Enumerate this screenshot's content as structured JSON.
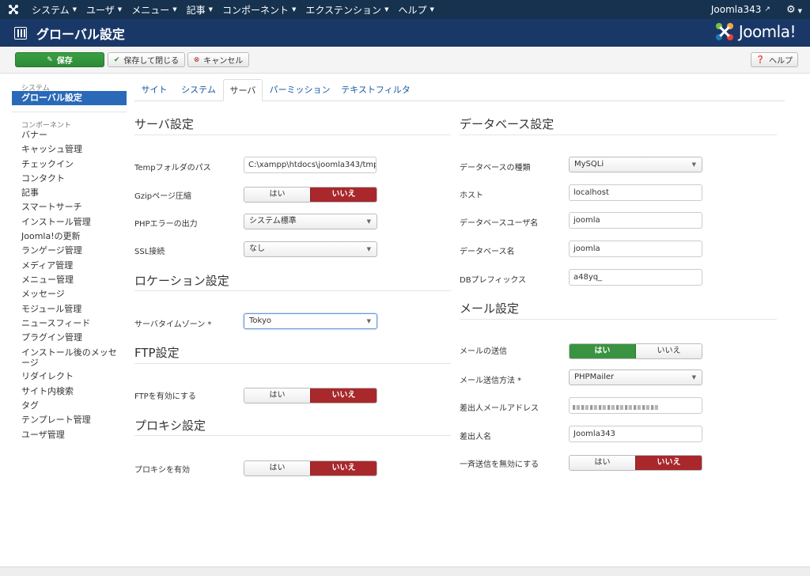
{
  "topnav": {
    "items": [
      "システム",
      "ユーザ",
      "メニュー",
      "記事",
      "コンポーネント",
      "エクステンション",
      "ヘルプ"
    ],
    "user": "Joomla343"
  },
  "header": {
    "title": "グローバル設定",
    "brand": "Joomla!"
  },
  "toolbar": {
    "save": "保存",
    "save_close": "保存して閉じる",
    "cancel": "キャンセル",
    "help": "ヘルプ"
  },
  "sidebar": {
    "section_system": "システム",
    "active": "グローバル設定",
    "section_components": "コンポーネント",
    "items": [
      "バナー",
      "キャッシュ管理",
      "チェックイン",
      "コンタクト",
      "記事",
      "スマートサーチ",
      "インストール管理",
      "Joomla!の更新",
      "ランゲージ管理",
      "メディア管理",
      "メニュー管理",
      "メッセージ",
      "モジュール管理",
      "ニュースフィード",
      "プラグイン管理",
      "インストール後のメッセージ",
      "リダイレクト",
      "サイト内検索",
      "タグ",
      "テンプレート管理",
      "ユーザ管理"
    ]
  },
  "tabs": [
    "サイト",
    "システム",
    "サーバ",
    "パーミッション",
    "テキストフィルタ"
  ],
  "server": {
    "title": "サーバ設定",
    "temp_label": "Tempフォルダのパス",
    "temp_value": "C:\\xampp\\htdocs\\joomla343/tmp",
    "gzip_label": "Gzipページ圧縮",
    "php_error_label": "PHPエラーの出力",
    "php_error_value": "システム標準",
    "ssl_label": "SSL接続",
    "ssl_value": "なし"
  },
  "location": {
    "title": "ロケーション設定",
    "tz_label": "サーバタイムゾーン *",
    "tz_value": "Tokyo"
  },
  "ftp": {
    "title": "FTP設定",
    "enable_label": "FTPを有効にする"
  },
  "proxy": {
    "title": "プロキシ設定",
    "enable_label": "プロキシを有効"
  },
  "database": {
    "title": "データベース設定",
    "type_label": "データベースの種類",
    "type_value": "MySQLi",
    "host_label": "ホスト",
    "host_value": "localhost",
    "user_label": "データベースユーザ名",
    "user_value": "joomla",
    "name_label": "データベース名",
    "name_value": "joomla",
    "prefix_label": "DBプレフィックス",
    "prefix_value": "a48yq_"
  },
  "mail": {
    "title": "メール設定",
    "send_label": "メールの送信",
    "method_label": "メール送信方法 *",
    "method_value": "PHPMailer",
    "from_email_label": "差出人メールアドレス",
    "from_name_label": "差出人名",
    "from_name_value": "Joomla343",
    "disable_mass_label": "一斉送信を無効にする"
  },
  "toggle": {
    "yes": "はい",
    "no": "いいえ"
  },
  "colors": {
    "nav": "#16324f",
    "header": "#1a3867",
    "active": "#2a69b8",
    "save": "#2d8a36",
    "no": "#a8282c",
    "yes": "#3a9340"
  }
}
